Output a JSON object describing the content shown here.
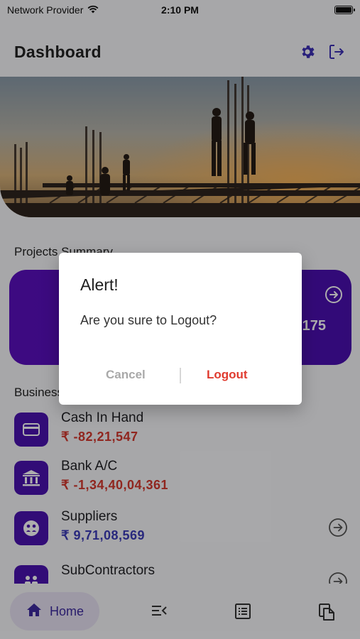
{
  "status_bar": {
    "carrier": "Network Provider",
    "time": "2:10 PM"
  },
  "header": {
    "title": "Dashboard"
  },
  "sections": {
    "projects_title": "Projects Summary",
    "business_title": "Business"
  },
  "projects_card": {
    "count_partial": "175"
  },
  "business_items": [
    {
      "name": "Cash In Hand",
      "amount": "₹ -82,21,547",
      "amount_color": "#d5382e"
    },
    {
      "name": "Bank A/C",
      "amount": "₹ -1,34,40,04,361",
      "amount_color": "#d5382e"
    },
    {
      "name": "Suppliers",
      "amount": "₹ 9,71,08,569",
      "amount_color": "#3c3bb8"
    },
    {
      "name": "SubContractors",
      "amount": "",
      "amount_color": "#3c3bb8"
    }
  ],
  "bottom_nav": {
    "home_label": "Home"
  },
  "dialog": {
    "title": "Alert!",
    "message": "Are you sure to Logout?",
    "cancel_label": "Cancel",
    "logout_label": "Logout"
  },
  "colors": {
    "primary": "#4b12b0",
    "accent_red": "#e03b2f",
    "overlay": "rgba(0,0,0,0.32)"
  }
}
